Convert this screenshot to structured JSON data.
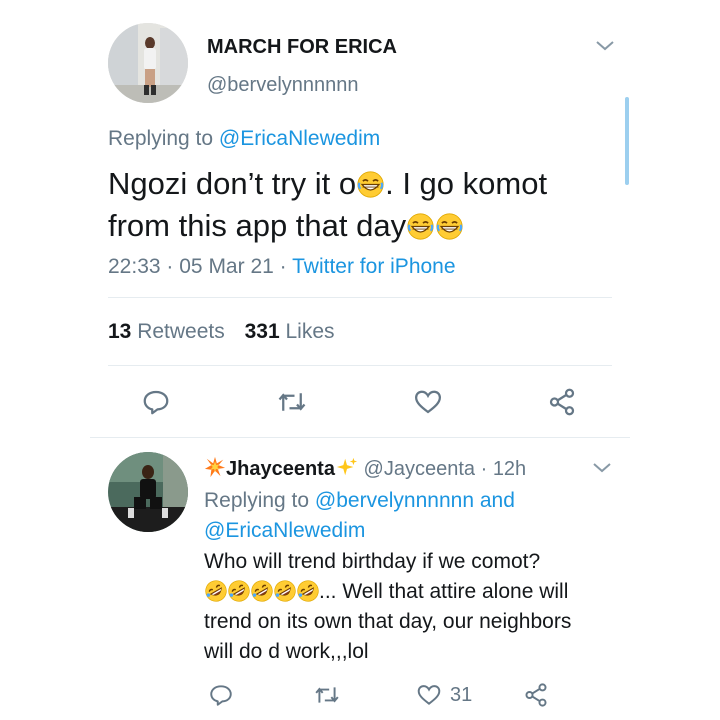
{
  "tweet": {
    "display_name": "MARCH FOR ERICA",
    "handle": "@bervelynnnnnn",
    "replying_prefix": "Replying to ",
    "replying_to": "@EricaNlewedim",
    "text_line1_a": "Ngozi don’t try it o",
    "text_line1_b": ". I go komot",
    "text_line2": "from this app that day",
    "time": "22:33",
    "date": "05 Mar 21",
    "source": "Twitter for iPhone",
    "sep": "·",
    "retweet_count": "13",
    "retweet_label": "Retweets",
    "like_count": "331",
    "like_label": "Likes"
  },
  "reply": {
    "display_name": "Jhayceenta",
    "handle": "@Jayceenta",
    "age": "12h",
    "sep": "·",
    "replying_prefix": "Replying to ",
    "replying_to_1": "@bervelynnnnnn",
    "and": " and",
    "replying_to_2": "@EricaNlewedim",
    "text_line1": "Who will trend birthday if we comot?",
    "text_line2_suffix": "... Well that attire alone will",
    "text_line3": "trend on its own that day, our neighbors",
    "text_line4": "will do d work,,,lol",
    "like_count": "31"
  },
  "icons": {
    "menu": "chevron-down-icon",
    "reply": "reply-icon",
    "retweet": "retweet-icon",
    "like": "heart-icon",
    "share": "share-icon",
    "emoji_laugh": "grinning-squinting-emoji",
    "emoji_rofl": "rolling-on-floor-laughing-emoji"
  },
  "colors": {
    "link": "#1b95e0",
    "muted": "#657786",
    "text": "#14171a",
    "divider": "#e6ecf0",
    "scrollbar": "#9ccfef"
  }
}
